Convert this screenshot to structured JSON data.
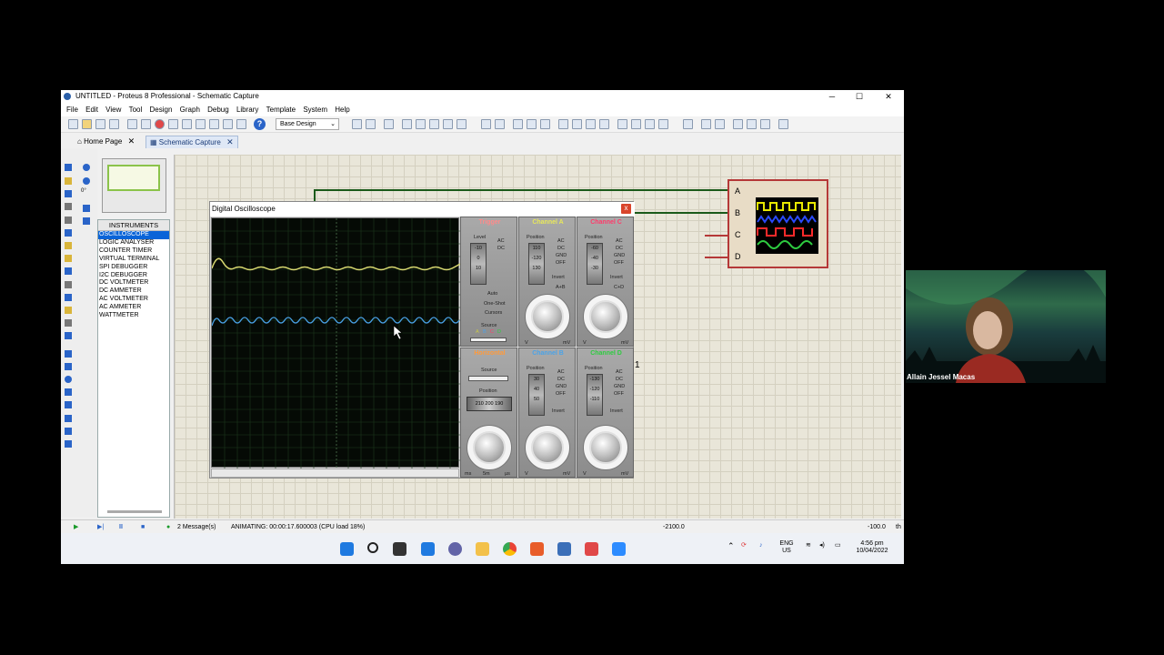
{
  "window": {
    "title": "UNTITLED - Proteus 8 Professional - Schematic Capture",
    "minimize": "─",
    "maximize": "☐",
    "close": "✕"
  },
  "menu": [
    "File",
    "Edit",
    "View",
    "Tool",
    "Design",
    "Graph",
    "Debug",
    "Library",
    "Template",
    "System",
    "Help"
  ],
  "toolbar": {
    "help": "?",
    "layer_select": "Base Design"
  },
  "tabs": [
    {
      "label": "Home Page",
      "active": false
    },
    {
      "label": "Schematic Capture",
      "active": true
    }
  ],
  "left_panel": {
    "rotation": "0°",
    "instruments_header": "INSTRUMENTS",
    "instruments": [
      "OSCILLOSCOPE",
      "LOGIC ANALYSER",
      "COUNTER TIMER",
      "VIRTUAL TERMINAL",
      "SPI DEBUGGER",
      "I2C DEBUGGER",
      "DC VOLTMETER",
      "DC AMMETER",
      "AC VOLTMETER",
      "AC AMMETER",
      "WATTMETER"
    ],
    "selected": "OSCILLOSCOPE"
  },
  "oscilloscope": {
    "title": "Digital Oscilloscope",
    "close": "x",
    "trigger_panel": {
      "header": "Trigger",
      "level_label": "Level",
      "coupling": [
        "AC",
        "DC"
      ],
      "level_strip": [
        "-10",
        "0",
        "10"
      ],
      "modes": [
        "Auto",
        "One-Shot",
        "Cursors"
      ],
      "source_label": "Source",
      "source_letters": [
        "A",
        "B",
        "C",
        "D"
      ]
    },
    "channel_a": {
      "header": "Channel A",
      "position_label": "Position",
      "position_strip": [
        "110",
        "-120",
        "130"
      ],
      "coupling": [
        "AC",
        "DC",
        "GND",
        "OFF"
      ],
      "invert": "Invert",
      "math": "A+B",
      "units": [
        "V",
        "mV"
      ]
    },
    "channel_c": {
      "header": "Channel C",
      "position_label": "Position",
      "position_strip": [
        "-60",
        "-40",
        "-30"
      ],
      "coupling": [
        "AC",
        "DC",
        "GND",
        "OFF"
      ],
      "invert": "Invert",
      "math": "C+D",
      "units": [
        "V",
        "mV"
      ]
    },
    "horizontal": {
      "header": "Horizontal",
      "source_label": "Source",
      "position_label": "Position",
      "position_strip": [
        "210",
        "200",
        "190"
      ],
      "units": [
        "ms",
        "5m",
        "µs"
      ]
    },
    "channel_b": {
      "header": "Channel B",
      "position_label": "Position",
      "position_strip": [
        "30",
        "40",
        "50"
      ],
      "coupling": [
        "AC",
        "DC",
        "GND",
        "OFF"
      ],
      "invert": "Invert",
      "units": [
        "V",
        "mV"
      ]
    },
    "channel_d": {
      "header": "Channel D",
      "position_label": "Position",
      "position_strip": [
        "-130",
        "-120",
        "-110"
      ],
      "coupling": [
        "AC",
        "DC",
        "GND",
        "OFF"
      ],
      "invert": "Invert",
      "units": [
        "V",
        "mV"
      ]
    }
  },
  "schematic": {
    "component_channels": [
      "A",
      "B",
      "C",
      "D"
    ],
    "label_near_panel": "1"
  },
  "status_bar": {
    "messages": "2 Message(s)",
    "animating": "ANIMATING: 00:00:17.600003 (CPU load 18%)",
    "coord_x": "-2100.0",
    "coord_y": "-100.0",
    "unit": "th"
  },
  "taskbar": {
    "lang": "ENG",
    "region": "US",
    "time": "4:56 pm",
    "date": "10/04/2022"
  },
  "webcam": {
    "name": "Allain Jessel Macas"
  },
  "colors": {
    "channel_a": "#e8e85a",
    "channel_b": "#4aa3e8",
    "channel_c": "#ff3a6a",
    "channel_d": "#2ecc40",
    "trigger_header": "#ff8a8a",
    "horizontal_header": "#ff9a3a",
    "selection": "#0a64d8"
  }
}
